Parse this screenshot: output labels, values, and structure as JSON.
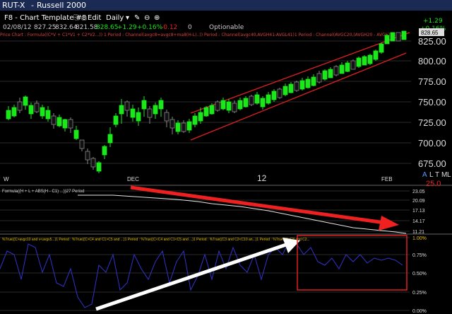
{
  "window": {
    "symbol": "RUT-X",
    "name": "Russell 2000"
  },
  "toolbar": {
    "template": "F8 - Chart Template #8",
    "edit": "Edit",
    "period": "Daily"
  },
  "quote": {
    "date": "02/08/12",
    "open": "827.25",
    "high": "832.64",
    "low": "821.58",
    "close": "828.65",
    "change": "+1.29",
    "change_pct": "+0.16%",
    "other_change": "-0.12",
    "volume": "0",
    "optionable": "Optionable",
    "right_change": "+1.29",
    "right_pct": "+0.16%",
    "last_tag": "828.65"
  },
  "main_panel": {
    "formula_label": "Price Chart : Formula((C*V + C1*V1 + C2*V2...)) 1 Period : Channel(avgc8=avgc8+ma8(H-L)..)) Period : Channel(avgc40,AVGH41-AVGL41)1 Period : Channel(AVGC20,(AVGH20 - AVGL20)...)",
    "price_axis": [
      "825.00",
      "800.00",
      "775.00",
      "750.00",
      "725.00",
      "700.00",
      "675.00"
    ],
    "x_labels": [
      "W",
      "DEC",
      "12",
      "FEB"
    ],
    "right_markers": [
      "A",
      "L",
      "T",
      "M",
      "L"
    ],
    "bottom_value": "25.0"
  },
  "indicator1": {
    "label": "Formula((H + L + ABS(H - C1) ...))27 Period",
    "axis": [
      "23.05",
      "20.09",
      "17.13",
      "14.17",
      "11.21"
    ]
  },
  "indicator2": {
    "label": "%True((C>avgc10 and v<avgv5...)1 Period : %True((C>C4 and C1>C5 and ...)1 Period : %True((C<C4 and C1<C5 and ...)1 Period : %True((C3 and C2<C10 an...)1 Period : %True((C<C8 and C2...",
    "axis": [
      "1.00%",
      "0.75%",
      "0.50%",
      "0.25%",
      "0.00%"
    ]
  },
  "colors": {
    "up_candle": "#19e819",
    "down_candle": "#111111",
    "channel": "#e02020",
    "arrow_red": "#ee2020",
    "arrow_white": "#ffffff",
    "indicator_line": "#3333cc",
    "grid": "#555555",
    "title_bar": "#1b2a52"
  }
}
